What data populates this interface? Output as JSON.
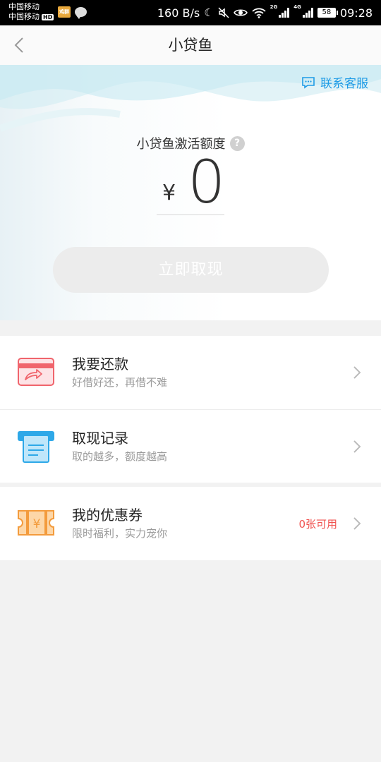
{
  "status_bar": {
    "carrier_1": "中国移动",
    "carrier_2": "中国移动",
    "hd_badge": "HD",
    "app_icon_text": "鸡群",
    "net_speed": "160 B/s",
    "network_1": "2G",
    "network_2": "4G",
    "battery": "58",
    "time": "09:28",
    "icons": [
      "moon-icon",
      "mute-icon",
      "eye-icon",
      "wifi-icon",
      "signal-icon",
      "battery-icon"
    ]
  },
  "nav": {
    "title": "小贷鱼",
    "back_icon": "chevron-left-icon"
  },
  "hero": {
    "support_label": "联系客服",
    "quota_label": "小贷鱼激活额度",
    "help_symbol": "?",
    "currency": "¥",
    "amount": "0",
    "withdraw_button": "立即取现"
  },
  "menu": {
    "repay": {
      "title": "我要还款",
      "subtitle": "好借好还，再借不难",
      "icon": "card-icon"
    },
    "records": {
      "title": "取现记录",
      "subtitle": "取的越多，额度越高",
      "icon": "receipt-icon"
    },
    "coupons": {
      "title": "我的优惠券",
      "subtitle": "限时福利，实力宠你",
      "badge": "0张可用",
      "icon": "coupon-icon",
      "coupon_symbol": "¥"
    }
  },
  "colors": {
    "accent_blue": "#1e9be6",
    "badge_red": "#f0524f",
    "button_disabled": "#ececec"
  }
}
